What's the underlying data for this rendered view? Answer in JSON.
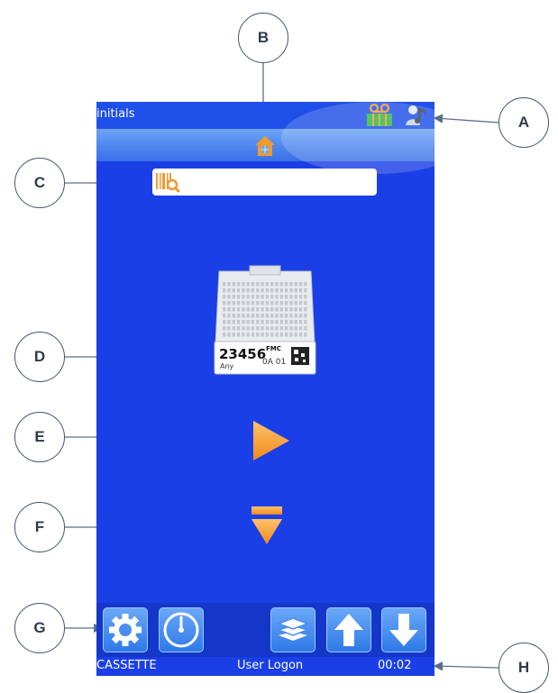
{
  "screen": {
    "title": "initials",
    "search": {
      "value": "",
      "placeholder": ""
    }
  },
  "status_bar": {
    "mode": "CASSETTE",
    "user": "User Logon",
    "time": "00:02"
  },
  "cassette": {
    "number": "23456",
    "superscript": "FMC",
    "label_left": "Any",
    "label_code": "0A 01"
  },
  "callouts": {
    "a": "A",
    "b": "B",
    "c": "C",
    "d": "D",
    "e": "E",
    "f": "F",
    "g": "G",
    "h": "H"
  },
  "icons": {
    "title_bar": [
      "cassette-magazine-icon",
      "person-music-icon"
    ],
    "nav": "home-icon",
    "search": "barcode-search-icon",
    "main": [
      "cassette-icon",
      "play-arrow-icon",
      "eject-icon"
    ],
    "footer": [
      "settings-gear-icon",
      "gauge-icon",
      "layers-icon",
      "arrow-up-icon",
      "arrow-down-icon"
    ]
  },
  "colors": {
    "screen_bg": "#1a3fe6",
    "accent_orange": "#f39a2d",
    "callout_border": "#44546a"
  }
}
